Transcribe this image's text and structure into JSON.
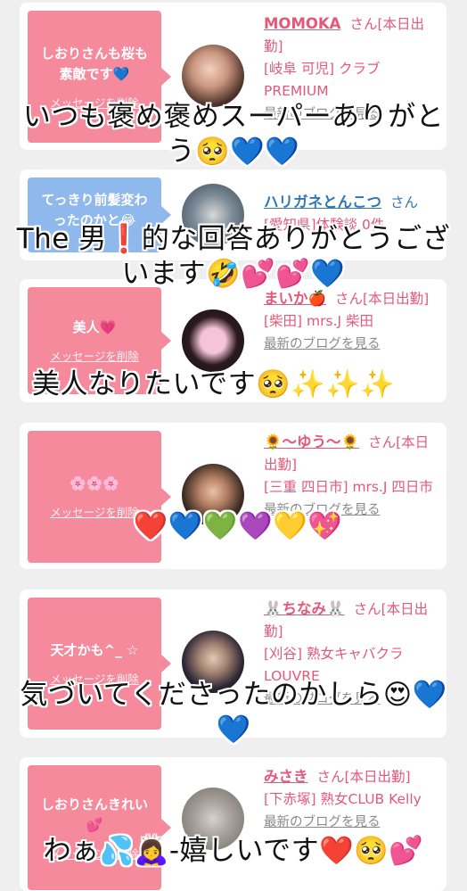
{
  "cards": [
    {
      "bubble_text": "しおりさんも桜も素敵です💙",
      "bubble_delete": "メッセージを削除",
      "name": "MOMOKA",
      "san": "さん[本日出勤]",
      "shop": "[岐阜 可児] クラブPREMIUM",
      "blog": "最新のブログを見る"
    },
    {
      "bubble_text": "てっきり前髪変わったのかと😂",
      "bubble_delete": "",
      "name": "ハリガネとんこつ",
      "san": "さん",
      "shop": "[愛知県]体験談 0件",
      "blog": ""
    },
    {
      "bubble_text": "美人💗",
      "bubble_delete": "メッセージを削除",
      "name": "まいか🍎",
      "san": "さん[本日出勤]",
      "shop": "[柴田] mrs.J 柴田",
      "blog": "最新のブログを見る"
    },
    {
      "bubble_text": "🌸🌸🌸",
      "bubble_delete": "メッセージを削除",
      "name": "🌻〜ゆう〜🌻",
      "san": "さん[本日出勤]",
      "shop": "[三重 四日市] mrs.J 四日市",
      "blog": "最新のブログを見る"
    },
    {
      "bubble_text": "天才かも^_ ☆",
      "bubble_delete": "メッセージを削除",
      "name": "🐰ちなみ🐰",
      "san": "さん[本日出勤]",
      "shop": "[刈谷] 熟女キャバクラ LOUVRE",
      "blog": "最新のブログを見る"
    },
    {
      "bubble_text": "しおりさんきれい💕",
      "bubble_delete": "メッセージを削除",
      "name": "みさき",
      "san": "さん[本日出勤]",
      "shop": "[下赤塚] 熟女CLUB Kelly",
      "blog": "最新のブログを見る"
    }
  ],
  "overlays": [
    "いつも褒め褒めスーパーありがとう🥺💙💙",
    "The 男❗️的な回答ありがとうございます🤣💕💕💙",
    "美人なりたいです🥺✨✨✨",
    "❤️💙💚💜💛💖",
    "気づいてくださったのかしら😍💙💙",
    "わぁ💦🙇‍♀️-嬉しいです❤️🥺💕"
  ],
  "colors": {
    "bubble_pink": "#f48a9c",
    "bubble_blue": "#8fb8ec",
    "name_pink": "#e4587a",
    "name_blue": "#2f77b5",
    "background": "#efefef"
  }
}
